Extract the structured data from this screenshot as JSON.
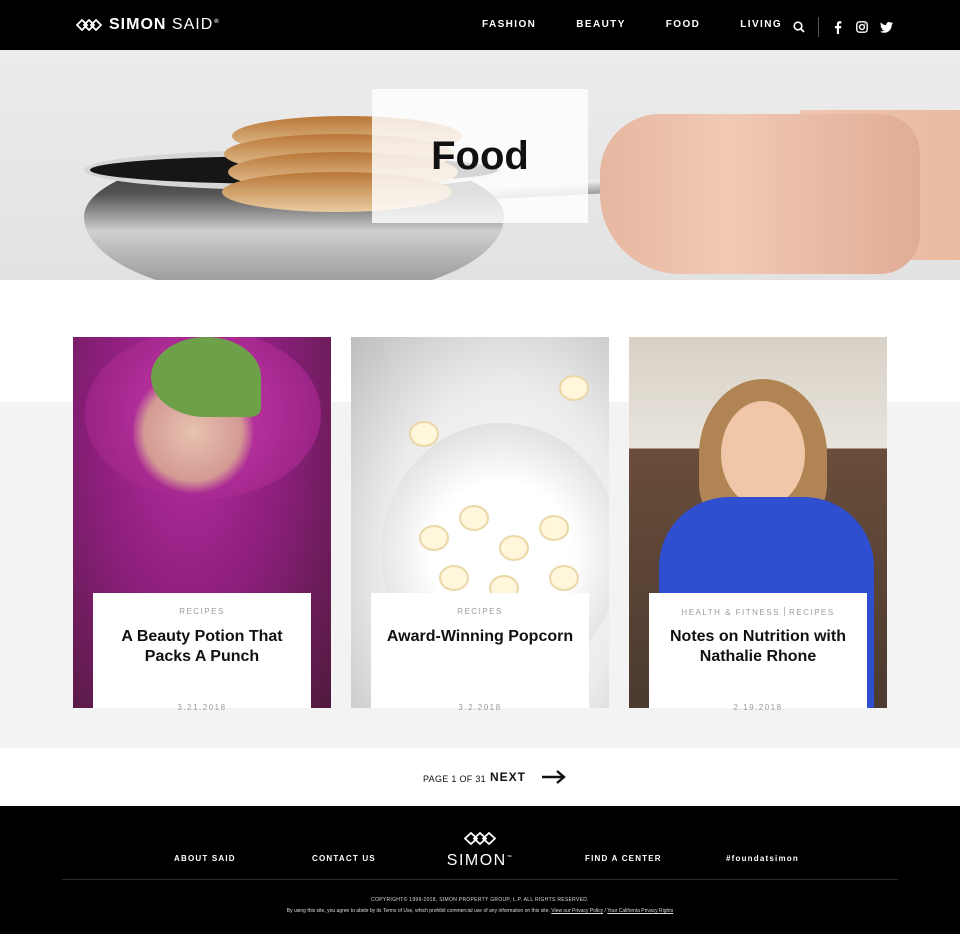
{
  "header": {
    "logo_main": "SIMON",
    "logo_sub": "SAID",
    "nav": [
      "FASHION",
      "BEAUTY",
      "FOOD",
      "LIVING"
    ]
  },
  "hero": {
    "title": "Food"
  },
  "articles": [
    {
      "category": "RECIPES",
      "title": "A Beauty Potion That Packs A Punch",
      "date": "3.21.2018"
    },
    {
      "category": "RECIPES",
      "title": "Award-Winning Popcorn",
      "date": "3.2.2018"
    },
    {
      "category_1": "HEALTH & FITNESS",
      "category_2": "RECIPES",
      "title": "Notes on Nutrition with Nathalie Rhone",
      "date": "2.19.2018"
    }
  ],
  "pagination": {
    "page_text": "PAGE 1 OF 31",
    "next_label": "NEXT"
  },
  "footer": {
    "links": [
      "ABOUT SAID",
      "CONTACT US",
      "FIND A CENTER",
      "#foundatsimon"
    ],
    "logo_text": "SIMON",
    "copyright": "COPYRIGHT© 1999-2018, SIMON PROPERTY GROUP, L.P. ALL RIGHTS RESERVED.",
    "legal_text": "By using this site, you agree to abide by its Terms of Use, which prohibit commercial use of any information on this site.",
    "privacy_link": "View our Privacy Policy",
    "legal_sep": "/",
    "california_link": "Your California Privacy Rights"
  },
  "colors": {
    "header_bg": "#000000",
    "band_bg": "#f3f3f3",
    "text": "#111111",
    "meta": "#9a9a9a"
  }
}
